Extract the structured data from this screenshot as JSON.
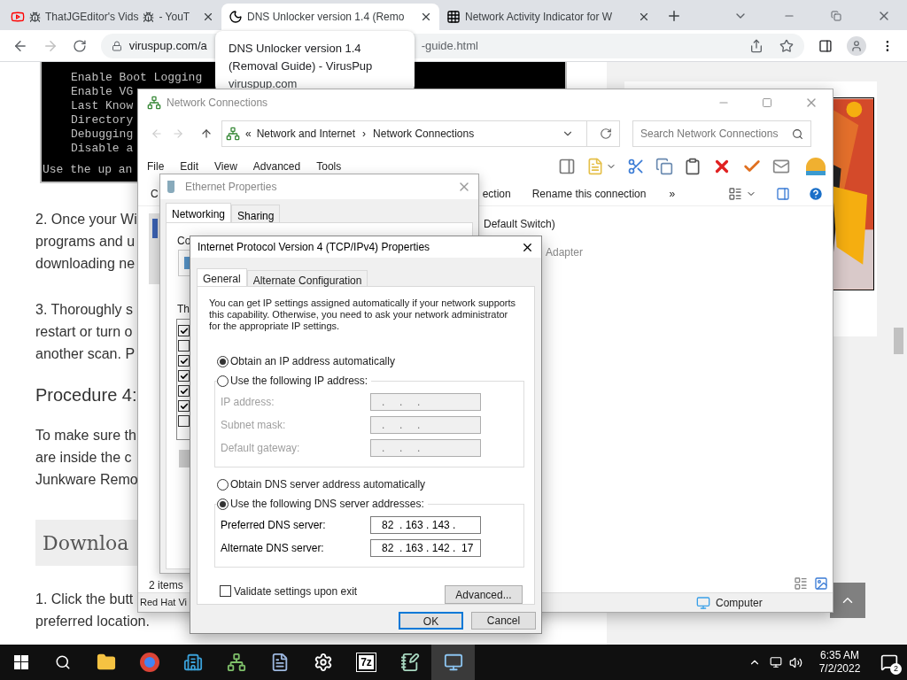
{
  "browser": {
    "tabs": [
      {
        "kind": "video",
        "title": "ThatJGEditor's Vids",
        "suffix": "- YouT",
        "selected": false
      },
      {
        "kind": "moon",
        "title": "DNS Unlocker version 1.4 (Remo",
        "selected": true
      },
      {
        "kind": "grid",
        "title": "Network Activity Indicator for W",
        "selected": false
      }
    ],
    "url_start": "viruspup.com/a",
    "url_end": "-guide.html",
    "tooltip": {
      "title": "DNS Unlocker version 1.4 (Removal Guide) - VirusPup",
      "domain": "viruspup.com"
    }
  },
  "article": {
    "terminal_lines": [
      "Enable Boot Logging",
      "Enable VG",
      "Last Know",
      "Directory",
      "Debugging",
      "Disable a"
    ],
    "terminal_footer": "Use the up an",
    "blocks": [
      {
        "kind": "para",
        "lines": [
          "2. Once your Wi",
          "programs and u",
          "downloading ne"
        ]
      },
      {
        "kind": "para",
        "lines": [
          "3. Thoroughly s",
          "restart or turn o",
          "another scan. P"
        ]
      },
      {
        "kind": "heading",
        "lines": [
          "Procedure 4:"
        ]
      },
      {
        "kind": "para",
        "lines": [
          "To make sure th",
          "are inside the c",
          "Junkware Remo"
        ]
      },
      {
        "kind": "banner",
        "lines": [
          "Downloa"
        ]
      },
      {
        "kind": "para",
        "lines": [
          "1. Click the butt",
          "preferred location."
        ]
      }
    ]
  },
  "network_window": {
    "title": "Network Connections",
    "breadcrumb_lead": "«",
    "breadcrumb": [
      "Network and Internet",
      "Network Connections"
    ],
    "breadcrumb_sep": "›",
    "search": {
      "placeholder": "Search Network Connections"
    },
    "menu": [
      "File",
      "Edit",
      "View",
      "Advanced",
      "Tools"
    ],
    "command_left": "C",
    "commands": [
      "ection",
      "Rename this connection"
    ],
    "more": "»",
    "items": [
      "Default Switch)",
      "Adapter"
    ],
    "item_count": "2 items",
    "status_left": "Red Hat Vi",
    "status_right": "Computer"
  },
  "ethernet_dialog": {
    "title": "Ethernet Properties",
    "tabs": [
      {
        "label": "Networking",
        "selected": true
      },
      {
        "label": "Sharing",
        "selected": false
      }
    ],
    "connect_label": "Co",
    "list_label": "Th",
    "components": [
      {
        "checked": true
      },
      {
        "checked": false
      },
      {
        "checked": true
      },
      {
        "checked": true
      },
      {
        "checked": true
      },
      {
        "checked": true
      },
      {
        "checked": false
      }
    ]
  },
  "ipv4_dialog": {
    "title": "Internet Protocol Version 4 (TCP/IPv4) Properties",
    "tabs": [
      {
        "label": "General",
        "selected": true
      },
      {
        "label": "Alternate Configuration",
        "selected": false
      }
    ],
    "description": "You can get IP settings assigned automatically if your network supports this capability. Otherwise, you need to ask your network administrator for the appropriate IP settings.",
    "ip_options": [
      {
        "label": "Obtain an IP address automatically",
        "selected": true
      },
      {
        "label": "Use the following IP address:",
        "selected": false
      }
    ],
    "ip_fields": [
      {
        "label": "IP address:",
        "value": ".     .     .",
        "disabled": true
      },
      {
        "label": "Subnet mask:",
        "value": ".     .     .",
        "disabled": true
      },
      {
        "label": "Default gateway:",
        "value": ".     .     .",
        "disabled": true
      }
    ],
    "dns_options": [
      {
        "label": "Obtain DNS server address automatically",
        "selected": false
      },
      {
        "label": "Use the following DNS server addresses:",
        "selected": true
      }
    ],
    "dns_fields": [
      {
        "label": "Preferred DNS server:",
        "value": "82  . 163 . 143 .",
        "disabled": false
      },
      {
        "label": "Alternate DNS server:",
        "value": "82  . 163 . 142 .  17",
        "disabled": false
      }
    ],
    "validate": {
      "label": "Validate settings upon exit",
      "checked": false
    },
    "advanced": "Advanced...",
    "ok": "OK",
    "cancel": "Cancel"
  },
  "taskbar": {
    "apps": [
      {
        "kind": "folder",
        "active": false
      },
      {
        "kind": "chrome",
        "active": false
      },
      {
        "kind": "buildings",
        "active": false
      },
      {
        "kind": "network",
        "active": false
      },
      {
        "kind": "document",
        "active": false
      },
      {
        "kind": "gear",
        "active": false
      },
      {
        "kind": "label",
        "label": "7z",
        "active": false
      },
      {
        "kind": "notepad",
        "active": false
      },
      {
        "kind": "connections",
        "active": true
      }
    ],
    "time": "6:35 AM",
    "date": "7/2/2022",
    "notifications": "2"
  }
}
